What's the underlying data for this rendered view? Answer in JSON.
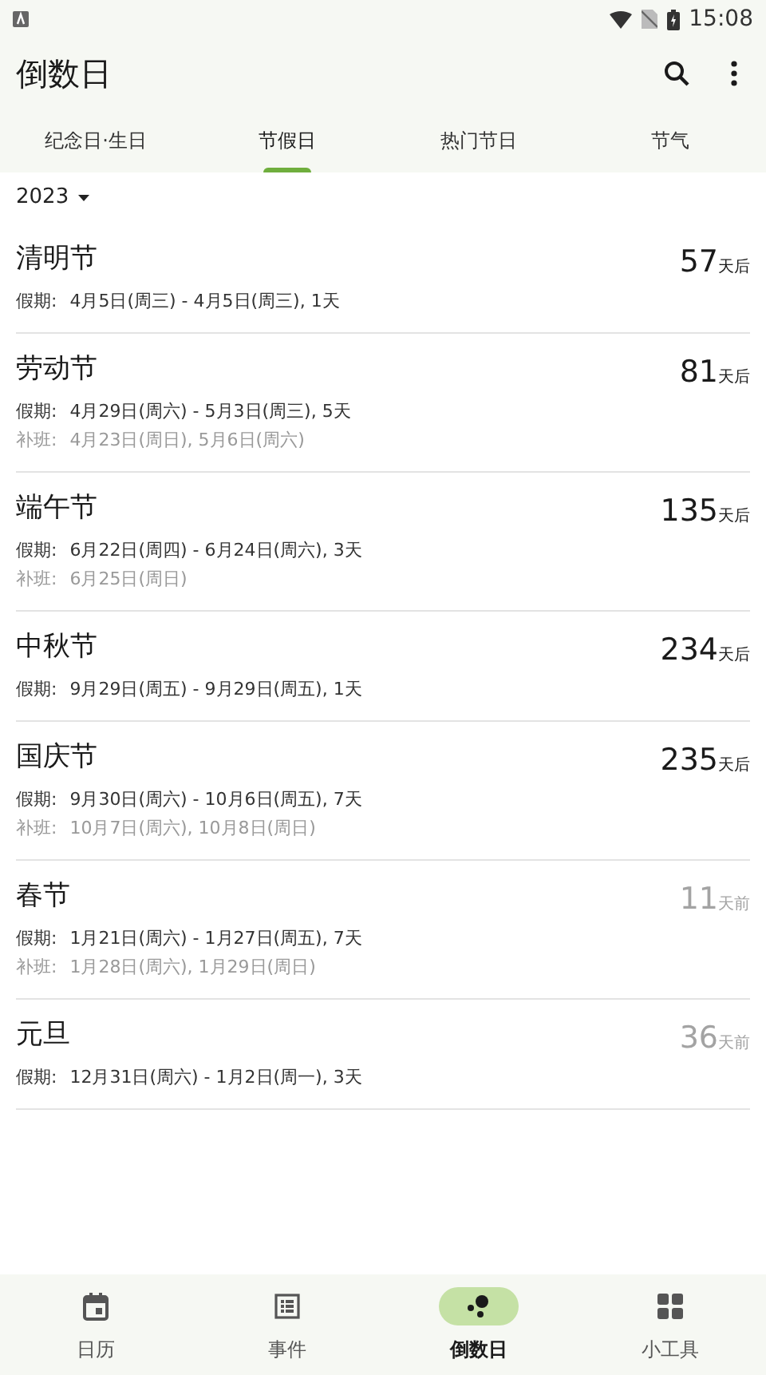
{
  "status_bar": {
    "time": "15:08"
  },
  "app_bar": {
    "title": "倒数日"
  },
  "tabs": [
    {
      "label": "纪念日·生日",
      "selected": false
    },
    {
      "label": "节假日",
      "selected": true
    },
    {
      "label": "热门节日",
      "selected": false
    },
    {
      "label": "节气",
      "selected": false
    }
  ],
  "year_selector": {
    "value": "2023"
  },
  "holidays": [
    {
      "name": "清明节",
      "days": "57",
      "suffix": "天后",
      "past": false,
      "vacation_label": "假期:",
      "vacation": "4月5日(周三) - 4月5日(周三), 1天"
    },
    {
      "name": "劳动节",
      "days": "81",
      "suffix": "天后",
      "past": false,
      "vacation_label": "假期:",
      "vacation": "4月29日(周六) - 5月3日(周三), 5天",
      "makeup_label": "补班:",
      "makeup": "4月23日(周日), 5月6日(周六)"
    },
    {
      "name": "端午节",
      "days": "135",
      "suffix": "天后",
      "past": false,
      "vacation_label": "假期:",
      "vacation": "6月22日(周四) - 6月24日(周六), 3天",
      "makeup_label": "补班:",
      "makeup": "6月25日(周日)"
    },
    {
      "name": "中秋节",
      "days": "234",
      "suffix": "天后",
      "past": false,
      "vacation_label": "假期:",
      "vacation": "9月29日(周五) - 9月29日(周五), 1天"
    },
    {
      "name": "国庆节",
      "days": "235",
      "suffix": "天后",
      "past": false,
      "vacation_label": "假期:",
      "vacation": "9月30日(周六) - 10月6日(周五), 7天",
      "makeup_label": "补班:",
      "makeup": "10月7日(周六), 10月8日(周日)"
    },
    {
      "name": "春节",
      "days": "11",
      "suffix": "天前",
      "past": true,
      "vacation_label": "假期:",
      "vacation": "1月21日(周六) - 1月27日(周五), 7天",
      "makeup_label": "补班:",
      "makeup": "1月28日(周六), 1月29日(周日)"
    },
    {
      "name": "元旦",
      "days": "36",
      "suffix": "天前",
      "past": true,
      "vacation_label": "假期:",
      "vacation": "12月31日(周六) - 1月2日(周一), 3天"
    }
  ],
  "bottom_nav": [
    {
      "label": "日历",
      "kind": "calendar",
      "selected": false
    },
    {
      "label": "事件",
      "kind": "list",
      "selected": false
    },
    {
      "label": "倒数日",
      "kind": "countdown",
      "selected": true
    },
    {
      "label": "小工具",
      "kind": "tools",
      "selected": false
    }
  ]
}
